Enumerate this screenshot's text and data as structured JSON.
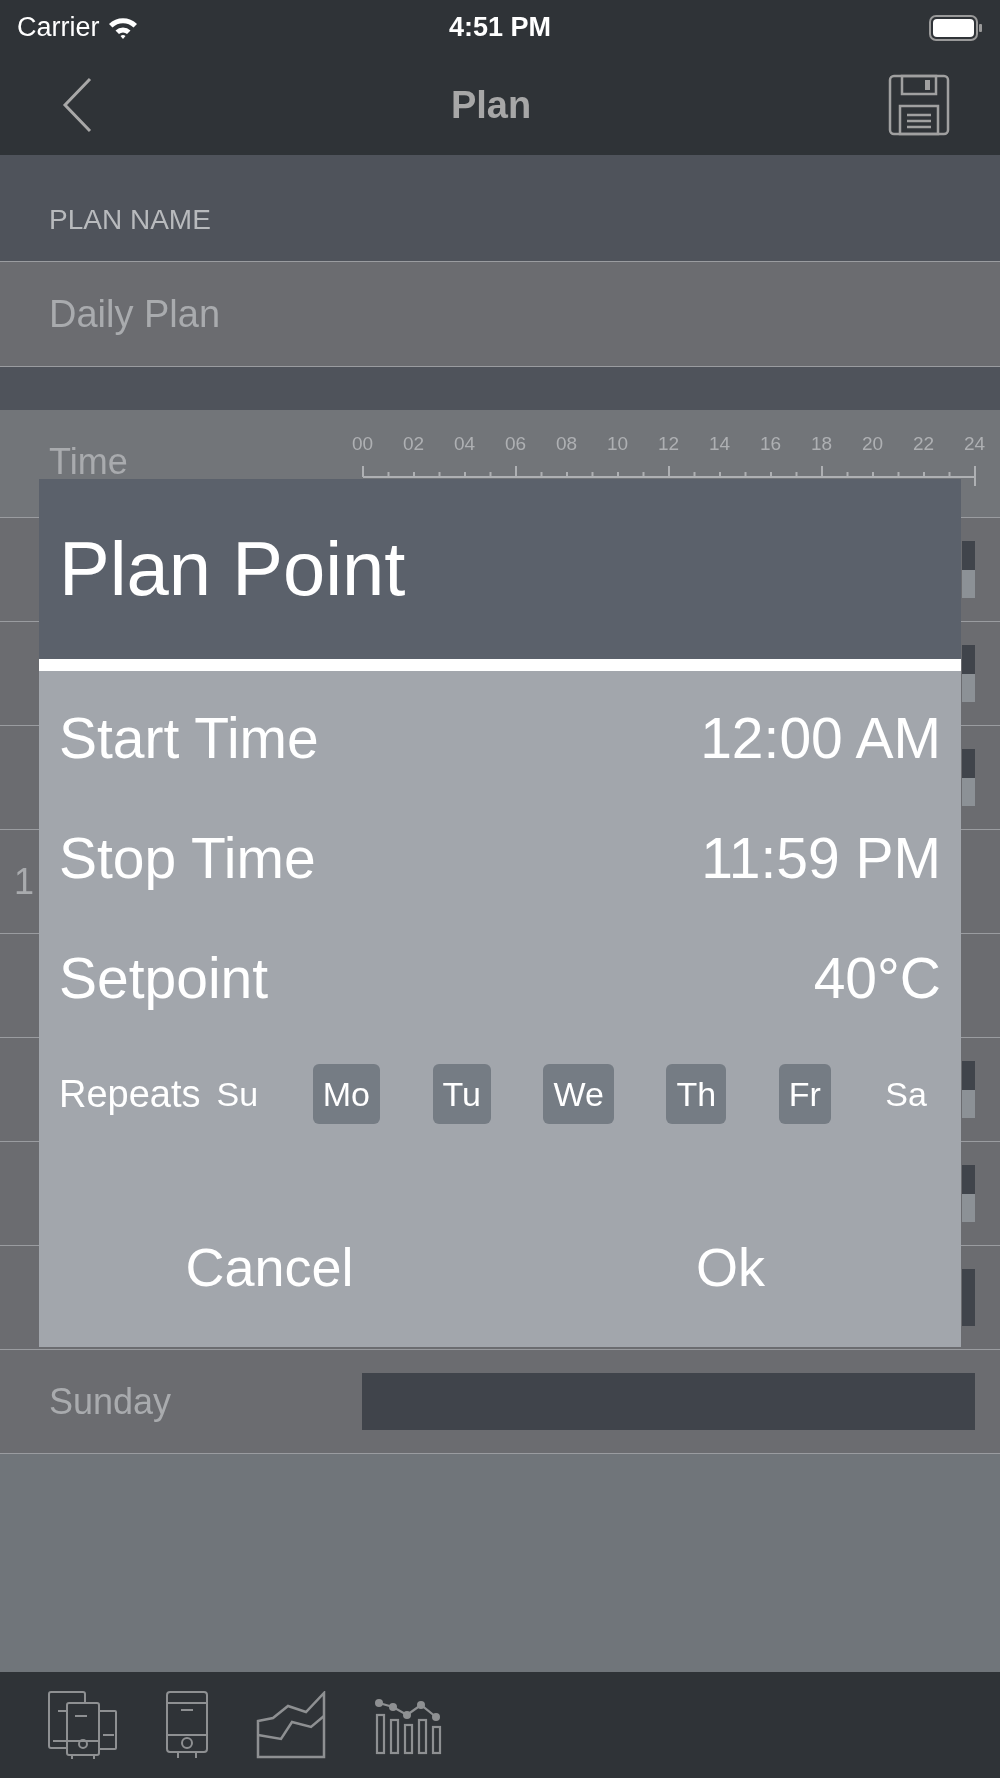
{
  "status_bar": {
    "carrier": "Carrier",
    "time": "4:51 PM"
  },
  "nav": {
    "title": "Plan"
  },
  "plan_name": {
    "header": "PLAN NAME",
    "value": "Daily Plan"
  },
  "timeline": {
    "label": "Time",
    "ticks": [
      "00",
      "02",
      "04",
      "06",
      "08",
      "10",
      "12",
      "14",
      "16",
      "18",
      "20",
      "22",
      "24"
    ]
  },
  "rows": [
    {
      "kind": "split"
    },
    {
      "kind": "split"
    },
    {
      "kind": "split"
    },
    {
      "kind": "empty",
      "label": "1"
    },
    {
      "kind": "empty"
    },
    {
      "kind": "split"
    },
    {
      "kind": "split"
    },
    {
      "kind": "dark"
    },
    {
      "kind": "full",
      "label": "Sunday"
    }
  ],
  "dialog": {
    "title": "Plan Point",
    "fields": [
      {
        "label": "Start Time",
        "value": "12:00 AM"
      },
      {
        "label": "Stop Time",
        "value": "11:59 PM"
      },
      {
        "label": "Setpoint",
        "value": "40°C"
      }
    ],
    "repeats": {
      "label": "Repeats",
      "days": [
        {
          "label": "Su",
          "selected": false
        },
        {
          "label": "Mo",
          "selected": true
        },
        {
          "label": "Tu",
          "selected": true
        },
        {
          "label": "We",
          "selected": true
        },
        {
          "label": "Th",
          "selected": true
        },
        {
          "label": "Fr",
          "selected": true
        },
        {
          "label": "Sa",
          "selected": false
        }
      ]
    },
    "buttons": [
      "Cancel",
      "Ok"
    ]
  }
}
